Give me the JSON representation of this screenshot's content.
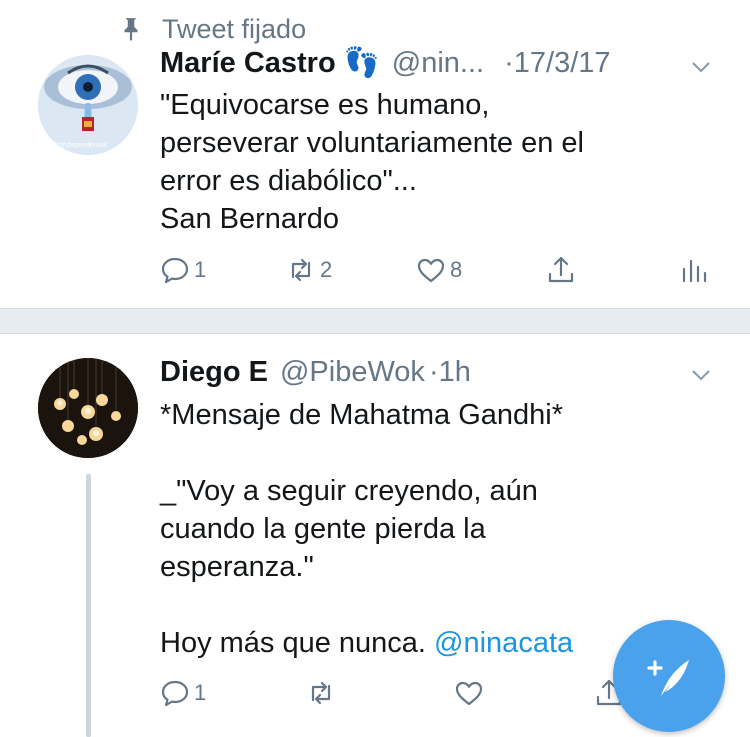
{
  "pinned": {
    "label": "Tweet fijado"
  },
  "tweets": [
    {
      "name": "Maríe Castro",
      "emoji": "👣",
      "handle": "@nin...",
      "time": "·17/3/17",
      "text": "\"Equivocarse es humano,\nperseverar voluntariamente en el\nerror es diabólico\"...\nSan Bernardo",
      "avatar_caption": "FelizIndependencia",
      "actions": {
        "replies": "1",
        "retweets": "2",
        "likes": "8"
      }
    },
    {
      "name": "Diego E",
      "handle": "@PibeWok",
      "time": "·1h",
      "text": "*Mensaje de Mahatma Gandhi*\n\n_\"Voy a seguir creyendo, aún\ncuando la gente pierda la\nesperanza.\"\n\nHoy más que nunca.",
      "mention": "@ninacata",
      "actions": {
        "replies": "1",
        "retweets": "",
        "likes": ""
      }
    }
  ],
  "colors": {
    "accent": "#1b95e0",
    "muted": "#657786",
    "fab": "#4aa1ec",
    "divider": "#e6ecf0"
  }
}
